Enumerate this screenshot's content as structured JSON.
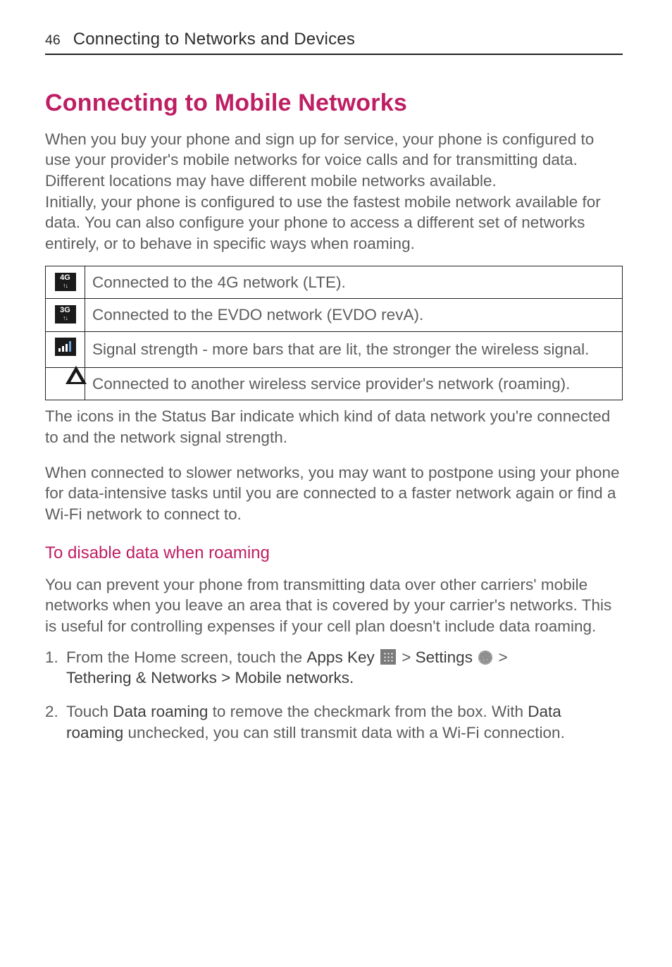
{
  "header": {
    "page_number": "46",
    "title": "Connecting to Networks and Devices"
  },
  "section": {
    "title": "Connecting to Mobile Networks",
    "intro_p1": "When you buy your phone and sign up for service, your phone is configured to use your provider's mobile networks for voice calls and for transmitting data.",
    "intro_p2": "Different locations may have different mobile networks available.",
    "intro_p3": "Initially, your phone is configured to use the fastest mobile network available for data. You can also configure your phone to access a different set of networks entirely, or to behave in specific ways when roaming."
  },
  "icon_table": [
    {
      "icon": "4g-icon",
      "desc": "Connected to the 4G network (LTE)."
    },
    {
      "icon": "3g-icon",
      "desc": "Connected to the EVDO network (EVDO revA)."
    },
    {
      "icon": "signal-bars-icon",
      "desc": "Signal strength -  more bars that are lit, the stronger the wireless signal."
    },
    {
      "icon": "roaming-icon",
      "desc": "Connected to another wireless service provider's network (roaming)."
    }
  ],
  "after_table": {
    "p1": "The icons in the Status Bar indicate which kind of data network you're connected to and the network signal strength.",
    "p2": "When connected to slower networks, you may want to postpone using your phone for data-intensive tasks until you are connected to a faster network again or find a Wi-Fi network to connect to."
  },
  "subsection": {
    "title": "To disable data when roaming",
    "intro": "You can prevent your phone from transmitting data over other carriers' mobile networks when you leave an area that is covered by your carrier's networks. This is useful for controlling expenses if your cell plan doesn't include data roaming.",
    "step1": {
      "pre": "From the Home screen, touch the ",
      "apps_key": "Apps Key",
      "sep1": " > ",
      "settings": "Settings",
      "sep2": " > ",
      "line2": "Tethering & Networks > Mobile networks."
    },
    "step2": {
      "pre": "Touch ",
      "s1": "Data roaming",
      "mid": " to remove the checkmark from the box. With ",
      "s2": "Data roaming",
      "post": " unchecked, you can still transmit data with a Wi-Fi connection."
    }
  }
}
